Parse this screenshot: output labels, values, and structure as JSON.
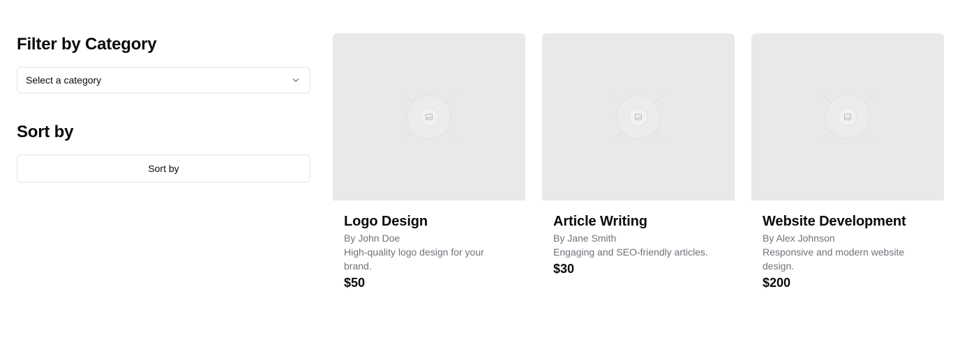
{
  "filter": {
    "title": "Filter by Category",
    "select_placeholder": "Select a category"
  },
  "sort": {
    "title": "Sort by",
    "button_label": "Sort by"
  },
  "cards": [
    {
      "title": "Logo Design",
      "author": "By John Doe",
      "description": "High-quality logo design for your brand.",
      "price": "$50",
      "image_icon": "image-placeholder-icon"
    },
    {
      "title": "Article Writing",
      "author": "By Jane Smith",
      "description": "Engaging and SEO-friendly articles.",
      "price": "$30",
      "image_icon": "image-placeholder-icon"
    },
    {
      "title": "Website Development",
      "author": "By Alex Johnson",
      "description": "Responsive and modern website design.",
      "price": "$200",
      "image_icon": "image-placeholder-icon"
    }
  ],
  "colors": {
    "border": "#e4e4e7",
    "muted_text": "#71717a",
    "placeholder_bg": "#e9e9e9"
  }
}
